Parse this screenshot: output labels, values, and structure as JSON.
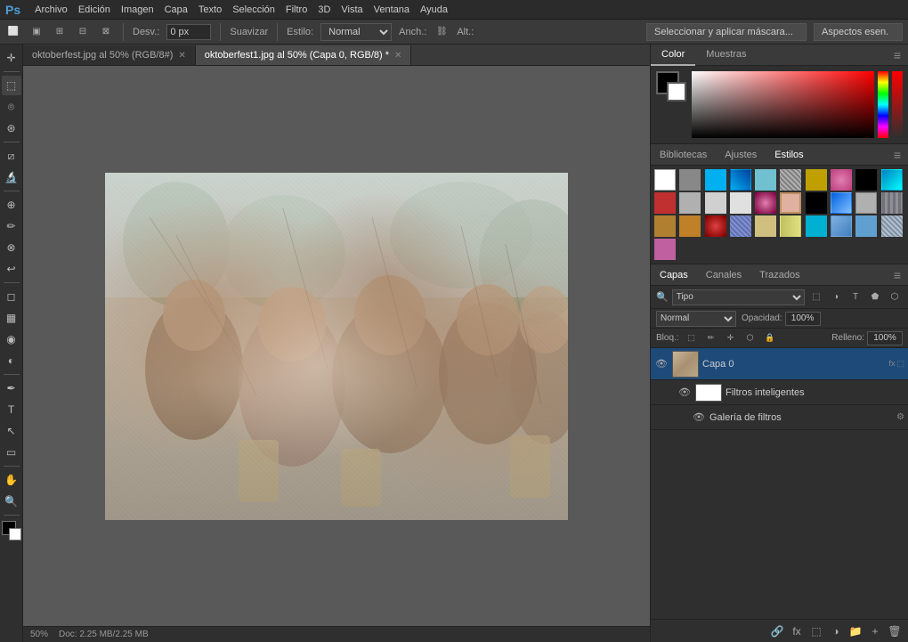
{
  "app": {
    "logo": "Ps",
    "title": "Adobe Photoshop"
  },
  "menubar": {
    "items": [
      "Archivo",
      "Edición",
      "Imagen",
      "Capa",
      "Texto",
      "Selección",
      "Filtro",
      "3D",
      "Vista",
      "Ventana",
      "Ayuda"
    ]
  },
  "optionsbar": {
    "desv_label": "Desv.:",
    "desv_value": "0 px",
    "suavizar_label": "Suavizar",
    "estilo_label": "Estilo:",
    "estilo_value": "Normal",
    "anch_label": "Anch.:",
    "alt_label": "Alt.:",
    "btn_seleccionar": "Seleccionar y aplicar máscara...",
    "btn_aspectos": "Aspectos esen."
  },
  "tabs": [
    {
      "label": "oktoberfest.jpg al 50% (RGB/8#)",
      "active": false
    },
    {
      "label": "oktoberfest1.jpg al 50% (Capa 0, RGB/8) *",
      "active": true
    }
  ],
  "statusbar": {
    "zoom": "50%",
    "doc_info": "Doc: 2.25 MB/2.25 MB"
  },
  "color_panel": {
    "tab_color": "Color",
    "tab_muestras": "Muestras"
  },
  "estilos_panel": {
    "tab_bibliotecas": "Bibliotecas",
    "tab_ajustes": "Ajustes",
    "tab_estilos": "Estilos",
    "swatches": [
      {
        "bg": "#fff",
        "border": "#aaa"
      },
      {
        "bg": "#888"
      },
      {
        "bg": "#00b0f0"
      },
      {
        "bg": "#00b0f0",
        "pattern": true
      },
      {
        "bg": "#70c0d0"
      },
      {
        "bg": "#808080",
        "pattern": true
      },
      {
        "bg": "#c0a000"
      },
      {
        "bg": "#c04080"
      },
      {
        "bg": "#f0f"
      },
      {
        "bg": "#00ffff"
      },
      {
        "bg": "#c03030"
      },
      {
        "bg": "#b0b0b0"
      },
      {
        "bg": "#d0d0d0"
      },
      {
        "bg": "#e0e0e0"
      },
      {
        "bg": "#c060a0"
      },
      {
        "bg": "#e0a0b0"
      },
      {
        "bg": "#c09000"
      },
      {
        "bg": "#d0a000"
      },
      {
        "bg": "#e04040"
      },
      {
        "bg": "#8090d0"
      },
      {
        "bg": "#b0b0b0"
      },
      {
        "bg": "#707080"
      },
      {
        "bg": "#b08030"
      },
      {
        "bg": "#c08028"
      },
      {
        "bg": "#4060c0"
      },
      {
        "bg": "#b0b0b0"
      },
      {
        "bg": "#c0a040"
      },
      {
        "bg": "#80a0d0"
      },
      {
        "bg": "#00b0d0"
      },
      {
        "bg": "#80b0e0"
      }
    ]
  },
  "capas_panel": {
    "tab_capas": "Capas",
    "tab_canales": "Canales",
    "tab_trazados": "Trazados",
    "filter_placeholder": "Tipo",
    "blend_mode": "Normal",
    "opacity_label": "Opacidad:",
    "opacity_value": "100%",
    "bloqueo_label": "Bloq.:",
    "relleno_label": "Relleno:",
    "relleno_value": "100%",
    "layers": [
      {
        "name": "Capa 0",
        "visible": true,
        "active": true,
        "type": "image"
      },
      {
        "name": "Filtros inteligentes",
        "visible": true,
        "active": false,
        "type": "filter_group",
        "indent": true
      },
      {
        "name": "Galería de filtros",
        "visible": true,
        "active": false,
        "type": "filter",
        "indent": true
      }
    ]
  },
  "tools": [
    "move",
    "marquee",
    "lasso",
    "quick-select",
    "crop",
    "eyedropper",
    "spot-heal",
    "brush",
    "clone",
    "history-brush",
    "eraser",
    "gradient",
    "blur",
    "dodge",
    "pen",
    "text",
    "path-select",
    "shape",
    "hand",
    "zoom"
  ]
}
